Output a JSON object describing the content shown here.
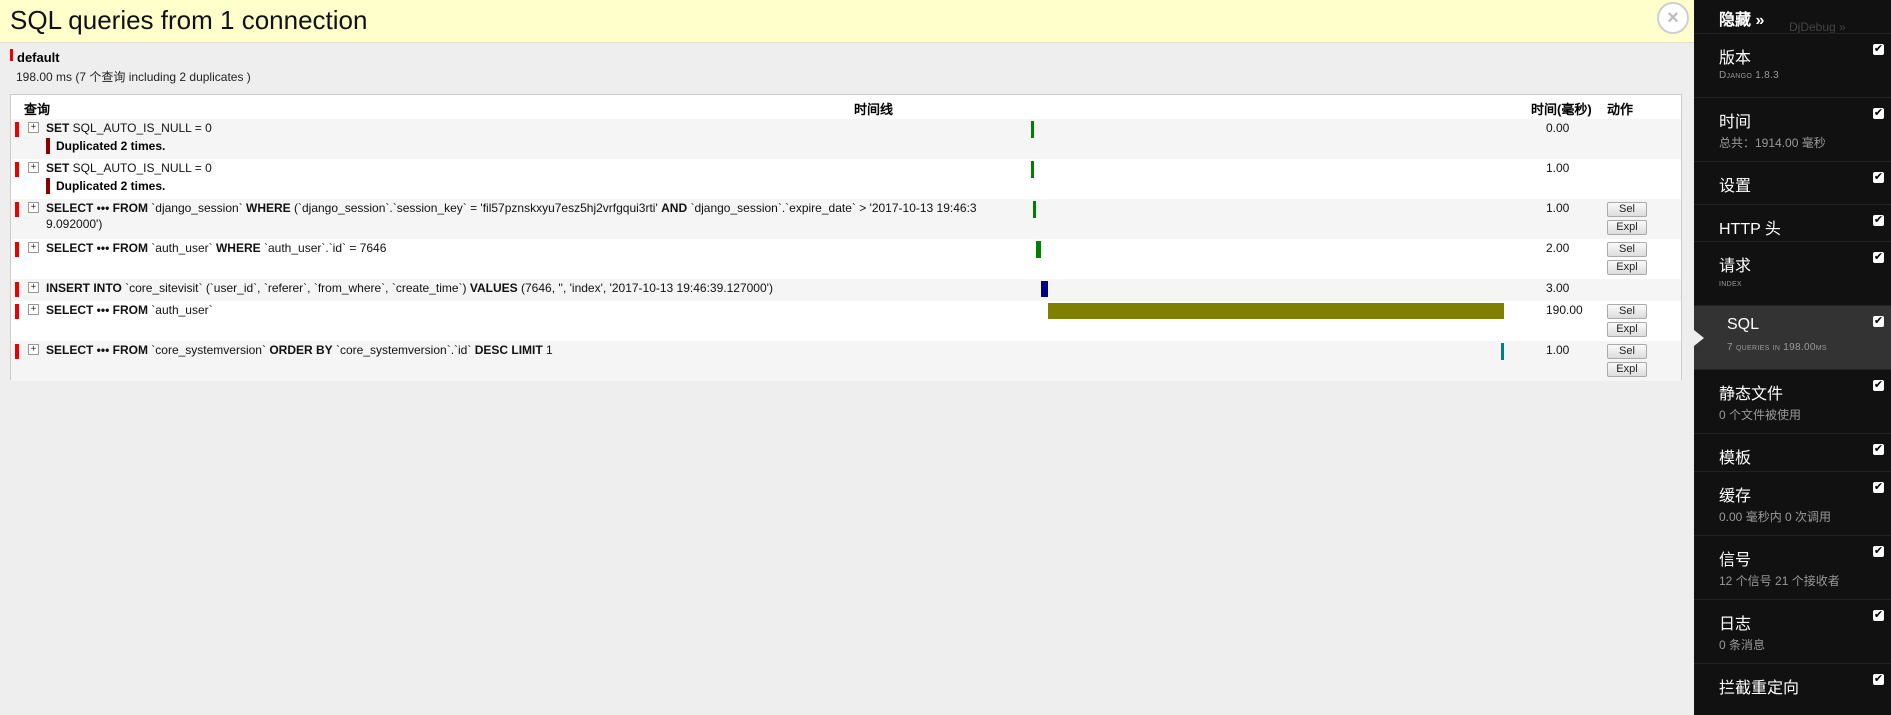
{
  "panel": {
    "title": "SQL queries from 1 connection",
    "close_label": "×"
  },
  "connection": {
    "name": "default",
    "summary": "198.00 ms (7 个查询 including 2 duplicates )"
  },
  "table": {
    "headers": {
      "query": "查询",
      "timeline": "时间线",
      "time": "时间(毫秒)",
      "action": "动作"
    },
    "toggle_glyph": "+",
    "queries": [
      {
        "parts": [
          [
            "kw",
            "SET"
          ],
          [
            "t",
            " SQL_AUTO_IS_NULL = 0"
          ]
        ],
        "duplicated": "Duplicated 2 times.",
        "time": "0.00",
        "bar_color": "#008000",
        "bar_start_pct": 0.0,
        "bar_width_pct": 0.0,
        "actions": []
      },
      {
        "parts": [
          [
            "kw",
            "SET"
          ],
          [
            "t",
            " SQL_AUTO_IS_NULL = 0"
          ]
        ],
        "duplicated": "Duplicated 2 times.",
        "time": "1.00",
        "bar_color": "#008000",
        "bar_start_pct": 0.0,
        "bar_width_pct": 0.505,
        "actions": []
      },
      {
        "parts": [
          [
            "kw",
            "SELECT ••• FROM"
          ],
          [
            "t",
            " `django_session` "
          ],
          [
            "kw",
            "WHERE"
          ],
          [
            "t",
            " (`django_session`.`session_key` = 'fil57pznskxyu7esz5hj2vrfgqui3rti' "
          ],
          [
            "kw",
            "AND"
          ],
          [
            "t",
            " `django_session`.`expire_date` > '2017-10-13 19:46:39.092000')"
          ]
        ],
        "duplicated": "",
        "time": "1.00",
        "bar_color": "#008000",
        "bar_start_pct": 0.505,
        "bar_width_pct": 0.505,
        "actions": [
          "Sel",
          "Expl"
        ]
      },
      {
        "parts": [
          [
            "kw",
            "SELECT ••• FROM"
          ],
          [
            "t",
            " `auth_user` "
          ],
          [
            "kw",
            "WHERE"
          ],
          [
            "t",
            " `auth_user`.`id` = 7646"
          ]
        ],
        "duplicated": "",
        "time": "2.00",
        "bar_color": "#008000",
        "bar_start_pct": 1.01,
        "bar_width_pct": 1.01,
        "actions": [
          "Sel",
          "Expl"
        ]
      },
      {
        "parts": [
          [
            "kw",
            "INSERT INTO"
          ],
          [
            "t",
            " `core_sitevisit` (`user_id`, `referer`, `from_where`, `create_time`) "
          ],
          [
            "kw",
            "VALUES"
          ],
          [
            "t",
            " (7646, '', 'index', '2017-10-13 19:46:39.127000')"
          ]
        ],
        "duplicated": "",
        "time": "3.00",
        "bar_color": "#000080",
        "bar_start_pct": 2.02,
        "bar_width_pct": 1.515,
        "actions": []
      },
      {
        "parts": [
          [
            "kw",
            "SELECT ••• FROM"
          ],
          [
            "t",
            " `auth_user`"
          ]
        ],
        "duplicated": "",
        "time": "190.00",
        "bar_color": "#808000",
        "bar_start_pct": 3.535,
        "bar_width_pct": 95.96,
        "actions": [
          "Sel",
          "Expl"
        ]
      },
      {
        "parts": [
          [
            "kw",
            "SELECT ••• FROM"
          ],
          [
            "t",
            " `core_systemversion` "
          ],
          [
            "kw",
            "ORDER BY"
          ],
          [
            "t",
            " `core_systemversion`.`id` "
          ],
          [
            "kw",
            "DESC LIMIT"
          ],
          [
            "t",
            " 1"
          ]
        ],
        "duplicated": "",
        "time": "1.00",
        "bar_color": "#008080",
        "bar_start_pct": 99.495,
        "bar_width_pct": 0.505,
        "actions": [
          "Sel",
          "Expl"
        ]
      }
    ]
  },
  "sidebar": {
    "hide_label": "隐藏 »",
    "hide_ghost": "DjDebug »",
    "check_glyph": "✔",
    "items": [
      {
        "title": "版本",
        "sub": "Django 1.8.3",
        "sc": true,
        "active": false
      },
      {
        "title": "时间",
        "sub": "总共：1914.00 毫秒",
        "sc": false,
        "active": false
      },
      {
        "title": "设置",
        "sub": "",
        "sc": false,
        "active": false
      },
      {
        "title": "HTTP 头",
        "sub": "",
        "sc": false,
        "active": false
      },
      {
        "title": "请求",
        "sub": "index",
        "sc": true,
        "active": false
      },
      {
        "title": "SQL",
        "sub": "7 queries in 198.00ms",
        "sc": true,
        "active": true
      },
      {
        "title": "静态文件",
        "sub": "0 个文件被使用",
        "sc": false,
        "active": false
      },
      {
        "title": "模板",
        "sub": "",
        "sc": false,
        "active": false
      },
      {
        "title": "缓存",
        "sub": "0.00 毫秒内 0 次调用",
        "sc": false,
        "active": false
      },
      {
        "title": "信号",
        "sub": "12 个信号 21 个接收者",
        "sc": false,
        "active": false
      },
      {
        "title": "日志",
        "sub": "0 条消息",
        "sc": false,
        "active": false
      },
      {
        "title": "拦截重定向",
        "sub": "",
        "sc": false,
        "active": false
      }
    ]
  }
}
